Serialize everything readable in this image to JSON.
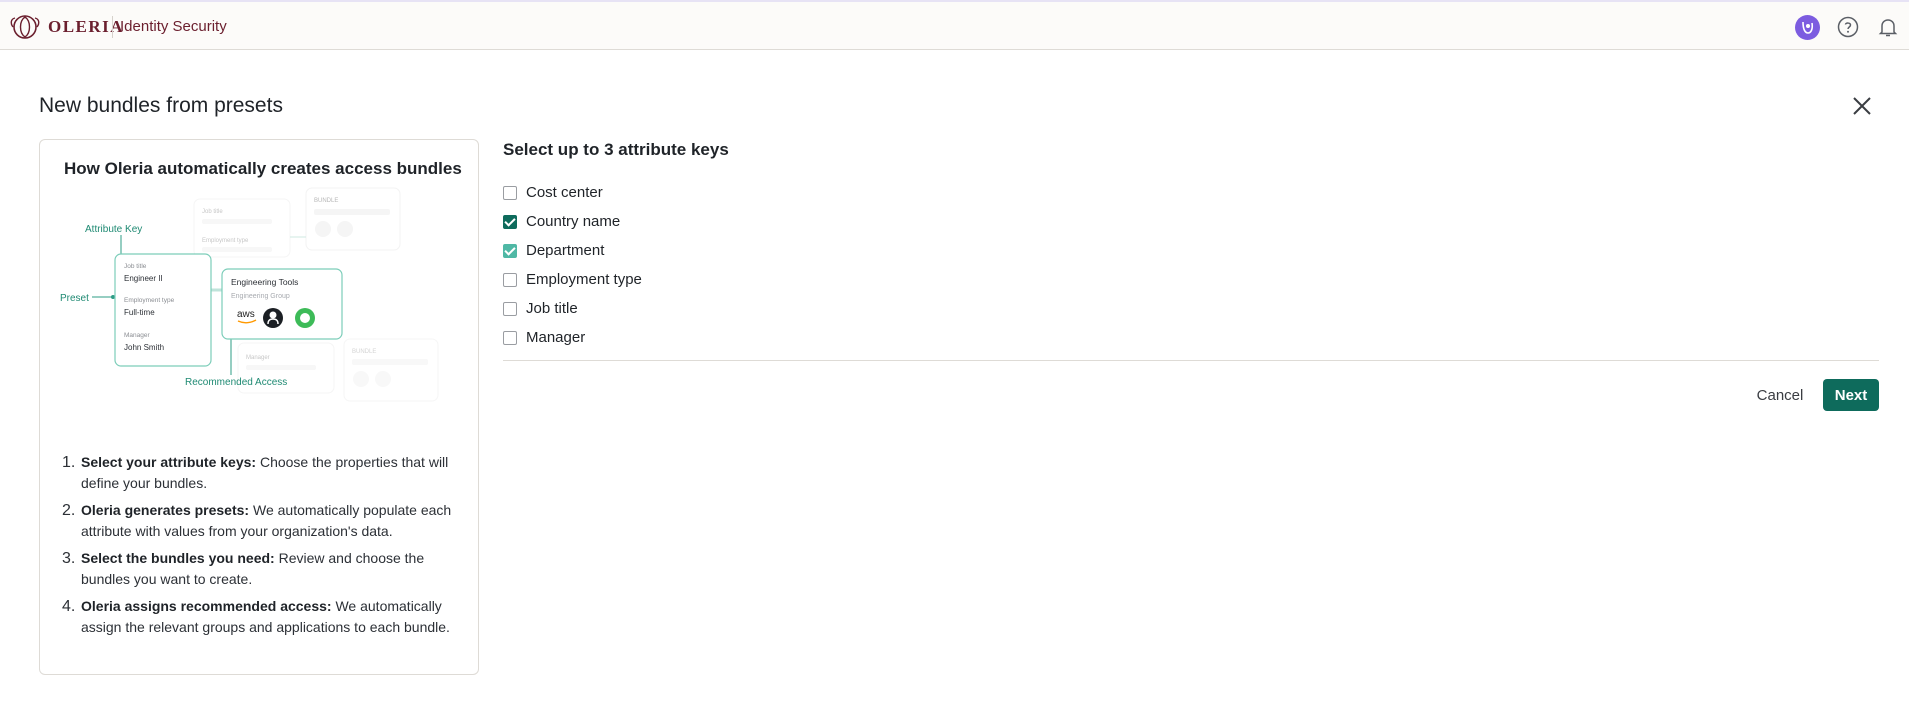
{
  "header": {
    "brand": "OLERIA",
    "product": "Identity Security"
  },
  "modal": {
    "title": "New bundles from presets"
  },
  "info_card": {
    "title": "How Oleria automatically creates access bundles",
    "illustration": {
      "attribute_key": "Attribute Key",
      "preset": "Preset",
      "recommended_access": "Recommended Access",
      "job_title_label": "Job title",
      "job_title_value": "Engineer II",
      "employment_type_label": "Employment type",
      "employment_type_value": "Full-time",
      "manager_label": "Manager",
      "manager_value": "John Smith",
      "bundle_name": "Engineering Tools",
      "bundle_group": "Engineering Group",
      "bundle_tag": "BUNDLE",
      "ghost_job_title": "Job title",
      "ghost_employment_type": "Employment type",
      "ghost_manager": "Manager",
      "aws_logo": "aws"
    },
    "steps": [
      {
        "num": "1.",
        "bold": "Select your attribute keys:",
        "text": " Choose the properties that will define your bundles."
      },
      {
        "num": "2.",
        "bold": "Oleria generates presets:",
        "text": " We automatically populate each attribute with values from your organization's data."
      },
      {
        "num": "3.",
        "bold": "Select the bundles you need:",
        "text": " Review and choose the bundles you want to create."
      },
      {
        "num": "4.",
        "bold": "Oleria assigns recommended access:",
        "text": " We automatically assign the relevant groups and applications to each bundle."
      }
    ]
  },
  "attributes": {
    "title": "Select up to 3 attribute keys",
    "options": [
      {
        "label": "Cost center",
        "checked": false
      },
      {
        "label": "Country name",
        "checked": true
      },
      {
        "label": "Department",
        "checked": true
      },
      {
        "label": "Employment type",
        "checked": false
      },
      {
        "label": "Job title",
        "checked": false
      },
      {
        "label": "Manager",
        "checked": false
      }
    ]
  },
  "footer": {
    "cancel_label": "Cancel",
    "next_label": "Next"
  },
  "colors": {
    "brand": "#6b1f2e",
    "primary": "#0e6b5c",
    "accent_light": "#4fb8a5",
    "avatar": "#7c5ce0"
  }
}
